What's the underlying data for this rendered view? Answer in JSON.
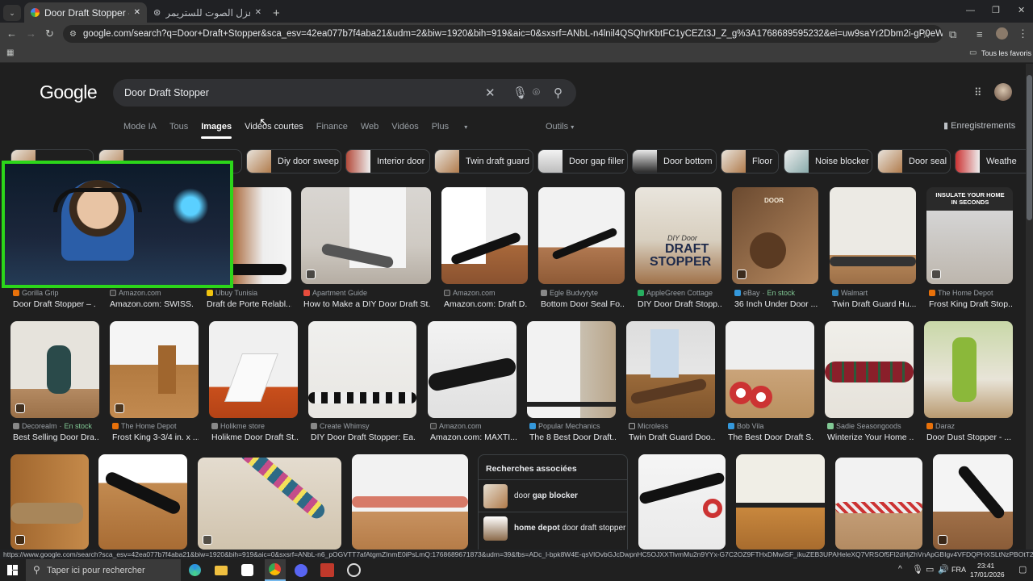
{
  "tabs": [
    {
      "title": "Door Draft Stopper - Recherche"
    },
    {
      "title": "حلول عزل الصوت للستريمر"
    }
  ],
  "address_bar": {
    "url": "google.com/search?q=Door+Draft+Stopper&sca_esv=42ea077b7f4aba21&udm=2&biw=1920&bih=919&aic=0&sxsrf=ANbL-n4lnil4QSQhrKbtFC1yCEZt3J_Z_g%3A1768689595232&ei=uw9saYr2Dbm2i-gP0eWTqAc&ved=0ahUKEwjKv6qY0pOSAxUS..."
  },
  "bookmarks": {
    "all_label": "Tous les favoris"
  },
  "google": {
    "logo": "Google",
    "query": "Door Draft Stopper",
    "nav_tabs": [
      "Mode IA",
      "Tous",
      "Images",
      "Vidéos courtes",
      "Finance",
      "Web",
      "Vidéos",
      "Plus"
    ],
    "tools": "Outils",
    "saved": "Enregistrements"
  },
  "chips": [
    "Diy door sweep",
    "Interior door",
    "Twin draft guard",
    "Door gap filler",
    "Door bottom",
    "Floor",
    "Noise blocker",
    "Door seal",
    "Weathe"
  ],
  "row1": [
    {
      "source": "Gorilla Grip",
      "title": "Door Draft Stopper – ..."
    },
    {
      "source": "Amazon.com",
      "title": "Amazon.com: SWISS..."
    },
    {
      "source": "Ubuy Tunisia",
      "title": "Draft de Porte Relabl..."
    },
    {
      "source": "Apartment Guide",
      "title": "How to Make a DIY Door Draft St..."
    },
    {
      "source": "Amazon.com",
      "title": "Amazon.com: Draft D..."
    },
    {
      "source": "Egle Budvytyte",
      "title": "Bottom Door Seal Fo..."
    },
    {
      "source": "AppleGreen Cottage",
      "title": "DIY Door Draft Stopp..."
    },
    {
      "source": "eBay",
      "stock": "En stock",
      "title": "36 Inch Under Door ..."
    },
    {
      "source": "Walmart",
      "title": "Twin Draft Guard Hu..."
    },
    {
      "source": "The Home Depot",
      "title": "Frost King Draft Stop..."
    }
  ],
  "row2": [
    {
      "source": "Decorealm",
      "stock": "En stock",
      "title": "Best Selling Door Dra..."
    },
    {
      "source": "The Home Depot",
      "title": "Frost King 3-3/4 in. x ..."
    },
    {
      "source": "Holikme store",
      "title": "Holikme Door Draft St..."
    },
    {
      "source": "Create Whimsy",
      "title": "DIY Door Draft Stopper: Ea..."
    },
    {
      "source": "Amazon.com",
      "title": "Amazon.com: MAXTI..."
    },
    {
      "source": "Popular Mechanics",
      "title": "The 8 Best Door Draft..."
    },
    {
      "source": "Microless",
      "title": "Twin Draft Guard Doo..."
    },
    {
      "source": "Bob Vila",
      "title": "The Best Door Draft S..."
    },
    {
      "source": "Sadie Seasongoods",
      "title": "Winterize Your Home ..."
    },
    {
      "source": "Daraz",
      "title": "Door Dust Stopper - ..."
    }
  ],
  "image_overlays": {
    "insulate": "INSULATE YOUR HOME IN SECONDS",
    "diy": "DIY Door",
    "draft": "DRAFT",
    "stopper": "STOPPER",
    "door": "DOOR"
  },
  "related": {
    "title": "Recherches associées",
    "items": [
      {
        "plain": "door ",
        "bold": "gap blocker"
      },
      {
        "plain": "door draft stopper",
        "bold": "home depot "
      }
    ]
  },
  "status_url": "https://www.google.com/search?sca_esv=42ea077b7f4aba21&biw=1920&bih=919&aic=0&sxsrf=ANbL-n6_pOGVTT7afAtgmZInmE0iPsLmQ:1768689671873&udm=39&fbs=ADc_l-bpk8W4E-qsVlOvbGJcDwpnHC5OJXXTlvmMu2n9YYx-G7C2OZ9FTHxDMwiSF_ikuZEB3UPAHeleXQ7VRSOf5Fl2dHjZhVnApGBIgv4VFDQPHXSLtNzPBOtT2Y1jZhR89iH16h5-i7D...",
  "taskbar": {
    "search": "Taper ici pour rechercher",
    "lang": "FRA",
    "time": "23:41",
    "date": "17/01/2026"
  },
  "colors": {
    "accent": "#8ab4f8",
    "webcam_border": "#2cd61a",
    "background": "#1f1f1f"
  }
}
